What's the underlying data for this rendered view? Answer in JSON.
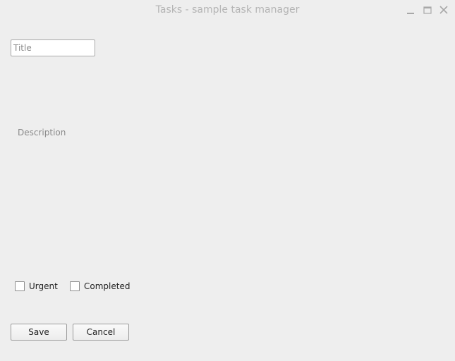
{
  "window": {
    "title": "Tasks - sample task manager"
  },
  "form": {
    "title_placeholder": "Title",
    "title_value": "",
    "description_placeholder": "Description",
    "description_value": "",
    "checkboxes": [
      {
        "label": "Urgent",
        "checked": false
      },
      {
        "label": "Completed",
        "checked": false
      }
    ]
  },
  "actions": {
    "save_label": "Save",
    "cancel_label": "Cancel"
  }
}
